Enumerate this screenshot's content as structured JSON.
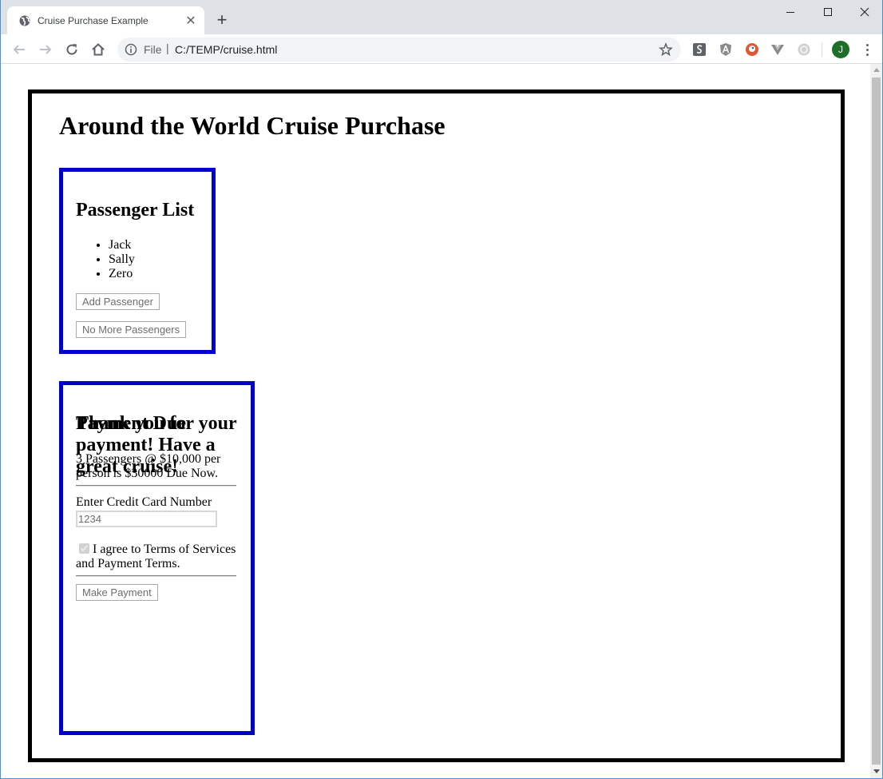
{
  "browser": {
    "tab_title": "Cruise Purchase Example",
    "tab_close": "✕",
    "new_tab": "+",
    "url_scheme": "File",
    "url_separator": "|",
    "url": "C:/TEMP/cruise.html",
    "avatar_letter": "J"
  },
  "page": {
    "title": "Around the World Cruise Purchase"
  },
  "passengers": {
    "heading": "Passenger List",
    "items": [
      "Jack",
      "Sally",
      "Zero"
    ],
    "add_button": "Add Passenger",
    "done_button": "No More Passengers"
  },
  "payment": {
    "heading": "Payment Due",
    "summary": "3 Passengers @ $10,000 per person is $30000 Due Now.",
    "cc_label": "Enter Credit Card Number",
    "cc_value": "1234",
    "agree_label": "I agree to Terms of Services and Payment Terms.",
    "agree_checked": true,
    "pay_button": "Make Payment",
    "thanks": "Thank you for your payment! Have a great cruise!"
  },
  "colors": {
    "panel_border": "#0000cc",
    "frame_border": "#000000"
  }
}
